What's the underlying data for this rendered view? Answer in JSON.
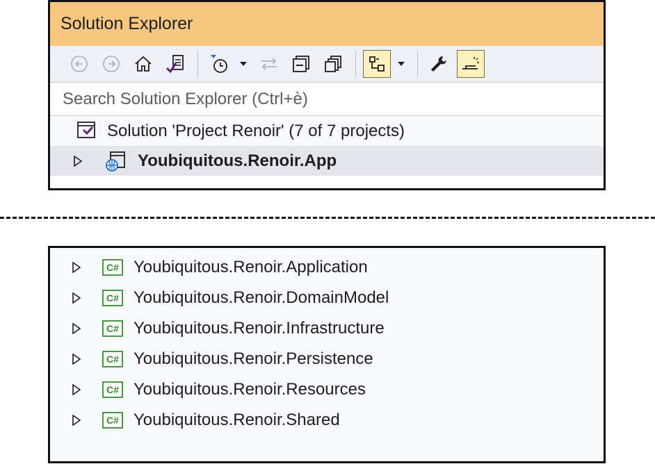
{
  "window": {
    "title": "Solution Explorer"
  },
  "toolbar": {
    "buttons": [
      {
        "icon": "back-icon"
      },
      {
        "icon": "forward-icon"
      },
      {
        "icon": "home-icon"
      },
      {
        "icon": "switch-views-icon"
      },
      {
        "icon": "pending-changes-filter-icon"
      },
      {
        "icon": "sync-icon"
      },
      {
        "icon": "collapse-all-icon"
      },
      {
        "icon": "show-all-files-icon"
      },
      {
        "icon": "view-class-diagram-icon",
        "active": true
      },
      {
        "icon": "properties-icon"
      },
      {
        "icon": "preview-selected-items-icon",
        "active": true
      }
    ]
  },
  "search": {
    "placeholder": "Search Solution Explorer (Ctrl+è)"
  },
  "tree": {
    "solution_label": "Solution 'Project Renoir' (7 of 7 projects)",
    "selected_project": "Youbiquitous.Renoir.App"
  },
  "projects": [
    {
      "label": "Youbiquitous.Renoir.Application",
      "icon_text": "C#"
    },
    {
      "label": "Youbiquitous.Renoir.DomainModel",
      "icon_text": "C#"
    },
    {
      "label": "Youbiquitous.Renoir.Infrastructure",
      "icon_text": "C#"
    },
    {
      "label": "Youbiquitous.Renoir.Persistence",
      "icon_text": "C#"
    },
    {
      "label": "Youbiquitous.Renoir.Resources",
      "icon_text": "C#"
    },
    {
      "label": "Youbiquitous.Renoir.Shared",
      "icon_text": "C#"
    }
  ],
  "colors": {
    "title_bar": "#f5c780",
    "csharp_icon": "#388a34",
    "vs_purple": "#68217a",
    "web_blue": "#1f6fd0"
  }
}
